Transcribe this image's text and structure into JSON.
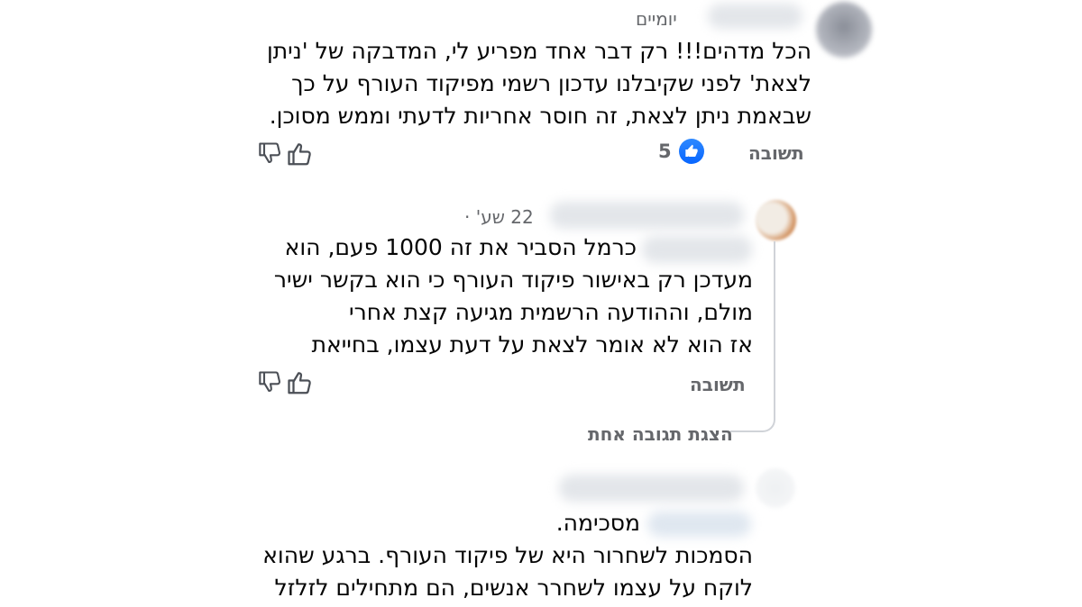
{
  "comments": [
    {
      "time": "יומיים",
      "lines": [
        "הכל מדהים!!! רק דבר אחד מפריע לי, המדבקה של 'ניתן",
        "לצאת' לפני שקיבלנו עדכון רשמי מפיקוד העורף על כך",
        "שבאמת ניתן לצאת, זה חוסר אחריות לדעתי וממש מסוכן."
      ],
      "reply_label": "תשובה",
      "like_count": "5"
    },
    {
      "time": "22 שע'",
      "separator": "·",
      "lines": [
        "כרמל הסביר את זה 1000 פעם, הוא",
        "מעדכן רק באישור פיקוד העורף כי הוא בקשר ישיר",
        "מולם, וההודעה הרשמית מגיעה קצת אחרי",
        "אז הוא לא אומר לצאת על דעת עצמו, בחייאת"
      ],
      "reply_label": "תשובה",
      "view_replies": "הצגת תגובה אחת"
    },
    {
      "lines": [
        "מסכימה.",
        "הסמכות לשחרור היא של פיקוד העורף. ברגע שהוא",
        "לוקח על עצמו לשחרר אנשים, הם מתחילים לזלזל"
      ]
    }
  ],
  "colors": {
    "like_blue": "#0866ff",
    "secondary_text": "#65676b",
    "primary_text": "#050505"
  },
  "icons": [
    "thumbs-down-icon",
    "thumbs-up-icon",
    "like-badge-icon"
  ]
}
